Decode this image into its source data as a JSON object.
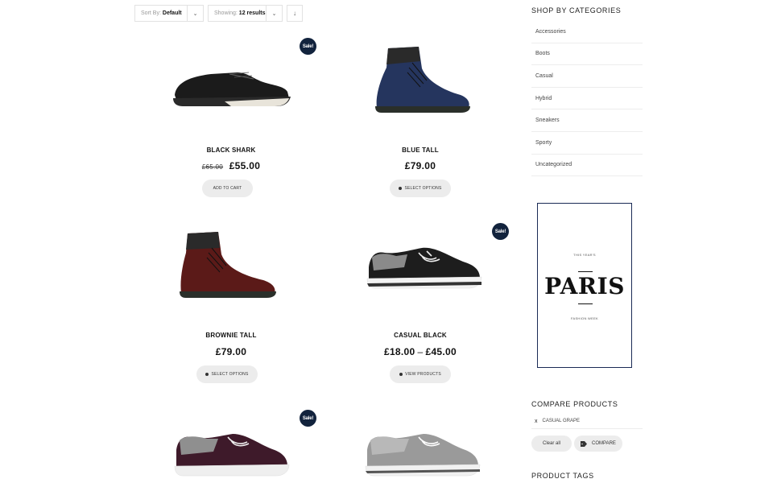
{
  "toolbar": {
    "sort_prefix": "Sort By:",
    "sort_value": "Default",
    "showing_prefix": "Showing:",
    "showing_value": "12 results",
    "chevron": "⌄",
    "order_icon": "↓"
  },
  "products": [
    {
      "name": "BLACK SHARK",
      "old_price": "£65.00",
      "price": "£55.00",
      "button": "ADD TO CART",
      "sale": "Sale!"
    },
    {
      "name": "BLUE TALL",
      "price": "£79.00",
      "button": "SELECT OPTIONS"
    },
    {
      "name": "BROWNIE TALL",
      "price": "£79.00",
      "button": "SELECT OPTIONS"
    },
    {
      "name": "CASUAL BLACK",
      "price_from": "£18.00",
      "price_sep": "–",
      "price_to": "£45.00",
      "button": "VIEW PRODUCTS",
      "sale": "Sale!"
    },
    {
      "sale": "Sale!"
    },
    {}
  ],
  "sidebar": {
    "categories_title": "SHOP BY CATEGORIES",
    "categories": [
      "Accessories",
      "Boots",
      "Casual",
      "Hybrid",
      "Sneakers",
      "Sporty",
      "Uncategorized"
    ],
    "banner": {
      "top_text": "THIS YEAR'S",
      "headline": "PARIS",
      "bottom_text": "FASHION WEEK"
    },
    "compare_title": "COMPARE PRODUCTS",
    "compare_item": {
      "remove": "x",
      "name": "CASUAL GRAPE"
    },
    "clear_all": "Clear all",
    "compare_button": "COMPARE",
    "tags_title": "PRODUCT TAGS"
  },
  "colors": {
    "sale_badge": "#12233d",
    "banner_border": "#1a2a55",
    "button_bg": "#ececec"
  }
}
